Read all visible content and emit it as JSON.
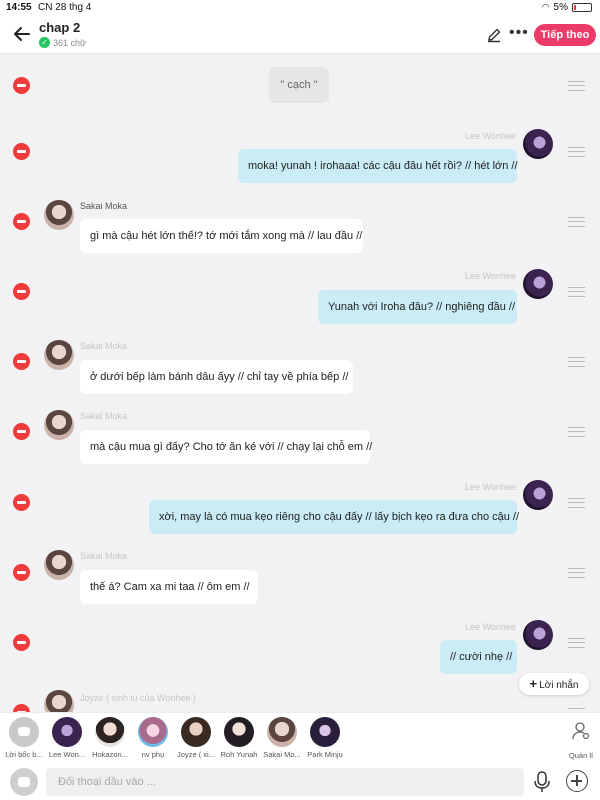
{
  "status_bar": {
    "time": "14:55",
    "date": "CN 28 thg 4",
    "battery": "5%"
  },
  "header": {
    "title": "chap 2",
    "word_count": "361 chữ",
    "continue_label": "Tiếp theo",
    "more": "•••"
  },
  "chip": {
    "text": "\" cạch \""
  },
  "messages": [
    {
      "side": "right",
      "name": "Lee Wonhee",
      "text": "moka! yunah ! irohaaa! các cậu đâu hết rồi? // hét lớn //"
    },
    {
      "side": "left",
      "name": "Sakai Moka",
      "text": "gì mà cậu hét lớn thế!? tớ mới tắm xong mà // lau đầu //"
    },
    {
      "side": "right",
      "name": "Lee Wonhee",
      "text": "Yunah với Iroha đâu? // nghiêng đầu //"
    },
    {
      "side": "left",
      "name": "Sakai Moka",
      "text": "ở dưới bếp làm bánh dâu ấyy // chỉ tay về phía bếp //"
    },
    {
      "side": "left",
      "name": "Sakai Moka",
      "text": "mà cậu mua gì đấy? Cho tớ ăn ké với // chạy lại chỗ em //"
    },
    {
      "side": "right",
      "name": "Lee Wonhee",
      "text": "xời, may là có mua kẹo riêng cho cậu đấy // lấy bịch kẹo ra đưa cho cậu //"
    },
    {
      "side": "left",
      "name": "Sakai Moka",
      "text": "thế á? Cam xa mi taa // ôm em //"
    },
    {
      "side": "right",
      "name": "Lee Wonhee",
      "text": "// cười nhẹ //"
    },
    {
      "side": "left",
      "name": "Joyze ( xinh iu của Wonhee )",
      "text": ""
    }
  ],
  "reply_button": {
    "label": "Lời nhắn"
  },
  "characters": [
    {
      "label": "Lời bốc b..."
    },
    {
      "label": "Lee Won..."
    },
    {
      "label": "Hokazon..."
    },
    {
      "label": "nv phụ"
    },
    {
      "label": "Joyze ( xi..."
    },
    {
      "label": "Roh Yunah"
    },
    {
      "label": "Sakai Mo..."
    },
    {
      "label": "Park Minju"
    }
  ],
  "manage": {
    "label": "Quản lí"
  },
  "input": {
    "placeholder": "Đối thoại đầu vào ..."
  },
  "colors": {
    "accent": "#ec3b66",
    "delete": "#ee3b3b",
    "bubble_right": "#c9ecf6",
    "bubble_left": "#ffffff"
  },
  "icons": [
    "back-arrow-icon",
    "edit-pencil-icon",
    "more-icon",
    "delete-icon",
    "drag-handle-icon",
    "plus-icon",
    "manage-user-icon",
    "mic-icon",
    "add-icon",
    "chat-bubble-icon"
  ]
}
